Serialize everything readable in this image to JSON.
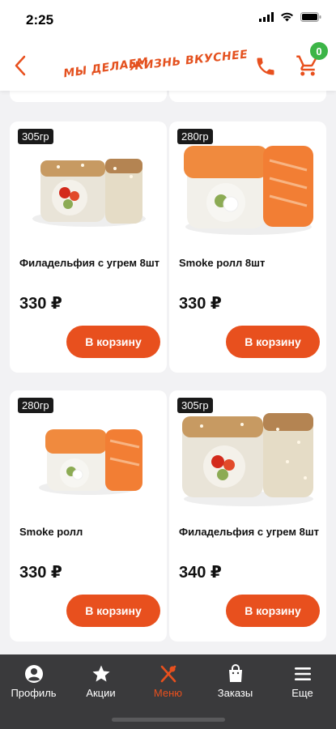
{
  "status_bar": {
    "time": "2:25"
  },
  "header": {
    "logo_line1": "МЫ ДЕЛАЕМ",
    "logo_line2": "ЖИЗНЬ ВКУСНЕЕ",
    "cart_count": "0"
  },
  "products": [
    {
      "weight": "305гр",
      "title": "Филадельфия с угрем 8шт",
      "price": "330 ₽",
      "button": "В корзину",
      "image": "eel-roll"
    },
    {
      "weight": "280гр",
      "title": "Smoke ролл 8шт",
      "price": "330 ₽",
      "button": "В корзину",
      "image": "salmon-roll"
    },
    {
      "weight": "280гр",
      "title": "Smoke ролл",
      "price": "330 ₽",
      "button": "В корзину",
      "image": "salmon-roll-small"
    },
    {
      "weight": "305гр",
      "title": "Филадельфия с угрем 8шт",
      "price": "340 ₽",
      "button": "В корзину",
      "image": "eel-roll"
    }
  ],
  "tabs": [
    {
      "label": "Профиль",
      "icon": "profile-icon",
      "active": false
    },
    {
      "label": "Акции",
      "icon": "star-icon",
      "active": false
    },
    {
      "label": "Меню",
      "icon": "menu-cutlery-icon",
      "active": true
    },
    {
      "label": "Заказы",
      "icon": "bag-icon",
      "active": false
    },
    {
      "label": "Еще",
      "icon": "hamburger-icon",
      "active": false
    }
  ],
  "colors": {
    "accent": "#e8501e",
    "badge_green": "#3cb547",
    "tab_bar": "#3a3a3c"
  }
}
